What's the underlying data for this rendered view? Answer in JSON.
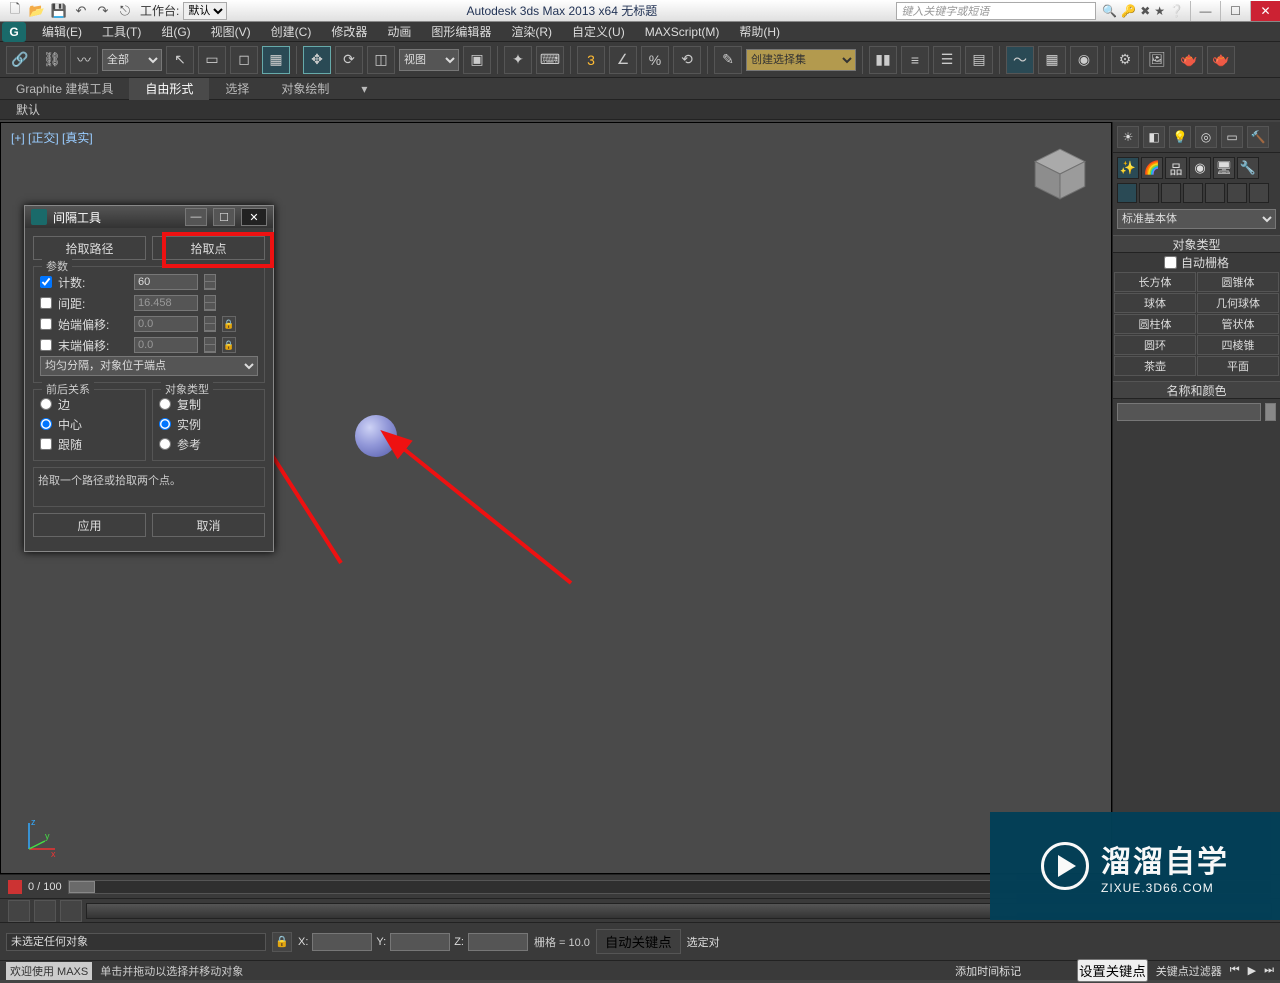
{
  "win": {
    "workspace_label": "工作台:",
    "workspace_value": "默认",
    "title": "Autodesk 3ds Max  2013 x64      无标题",
    "search_placeholder": "键入关键字或短语",
    "min": "—",
    "max": "☐",
    "close": "✕"
  },
  "menu": {
    "items": [
      "编辑(E)",
      "工具(T)",
      "组(G)",
      "视图(V)",
      "创建(C)",
      "修改器",
      "动画",
      "图形编辑器",
      "渲染(R)",
      "自定义(U)",
      "MAXScript(M)",
      "帮助(H)"
    ]
  },
  "toolbar": {
    "sel_filter": "全部",
    "ref_coord": "视图",
    "named_sel": "创建选择集"
  },
  "ribbon": {
    "tabs": [
      "Graphite 建模工具",
      "自由形式",
      "选择",
      "对象绘制"
    ],
    "active": 1,
    "sub": "默认"
  },
  "viewport": {
    "label": "[+] [正交] [真实]"
  },
  "dialog": {
    "title": "间隔工具",
    "pick_path": "拾取路径",
    "pick_point": "拾取点",
    "group_params": "参数",
    "count_lbl": "计数:",
    "count_val": "60",
    "spacing_lbl": "间距:",
    "spacing_val": "16.458",
    "start_lbl": "始端偏移:",
    "start_val": "0.0",
    "end_lbl": "末端偏移:",
    "end_val": "0.0",
    "mode": "均匀分隔，对象位于端点",
    "group_context": "前后关系",
    "ctx_edge": "边",
    "ctx_center": "中心",
    "ctx_follow": "跟随",
    "group_objtype": "对象类型",
    "ot_copy": "复制",
    "ot_inst": "实例",
    "ot_ref": "参考",
    "hint": "拾取一个路径或拾取两个点。",
    "apply": "应用",
    "cancel": "取消"
  },
  "cmd": {
    "category": "标准基本体",
    "rollout_objtype": "对象类型",
    "autogrid": "自动栅格",
    "primitives": [
      "长方体",
      "圆锥体",
      "球体",
      "几何球体",
      "圆柱体",
      "管状体",
      "圆环",
      "四棱锥",
      "茶壶",
      "平面"
    ],
    "rollout_namecolor": "名称和颜色"
  },
  "timeline": {
    "frames": "0 / 100"
  },
  "status": {
    "selection": "未选定任何对象",
    "x_lbl": "X:",
    "y_lbl": "Y:",
    "z_lbl": "Z:",
    "grid": "栅格 = 10.0",
    "autokey": "自动关键点",
    "selkey": "选定对",
    "setkey": "设置关键点",
    "keyfilter": "关键点过滤器",
    "addmarker": "添加时间标记"
  },
  "status2": {
    "welcome": "欢迎使用 MAXS",
    "tip": "单击并拖动以选择并移动对象"
  },
  "watermark": {
    "line1": "溜溜自学",
    "line2": "ZIXUE.3D66.COM"
  }
}
